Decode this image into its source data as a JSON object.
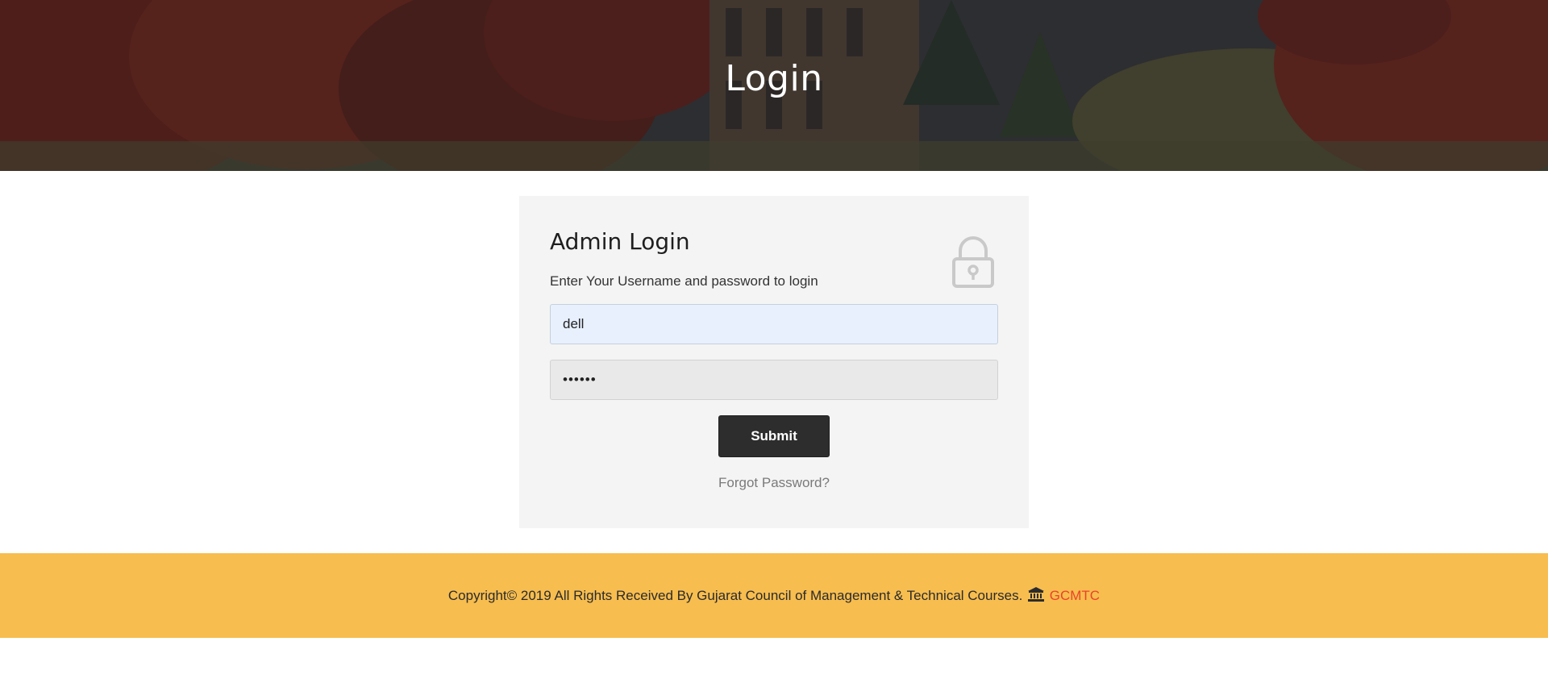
{
  "hero": {
    "title": "Login"
  },
  "login": {
    "title": "Admin Login",
    "subtitle": "Enter Your Username and password to login",
    "username_value": "dell",
    "password_value": "••••••",
    "submit_label": "Submit",
    "forgot_label": "Forgot Password?",
    "lock_icon": "lock-icon"
  },
  "footer": {
    "copyright": "Copyright© 2019 All Rights Received By Gujarat Council of Management & Technical Courses.",
    "brand": "GCMTC",
    "brand_icon": "institution-icon"
  },
  "colors": {
    "footer_bg": "#f7bd4f",
    "brand_accent": "#e8442a",
    "button_bg": "#2d2d2d",
    "card_bg": "#f4f4f4",
    "autofill_bg": "#e8f0fe"
  }
}
